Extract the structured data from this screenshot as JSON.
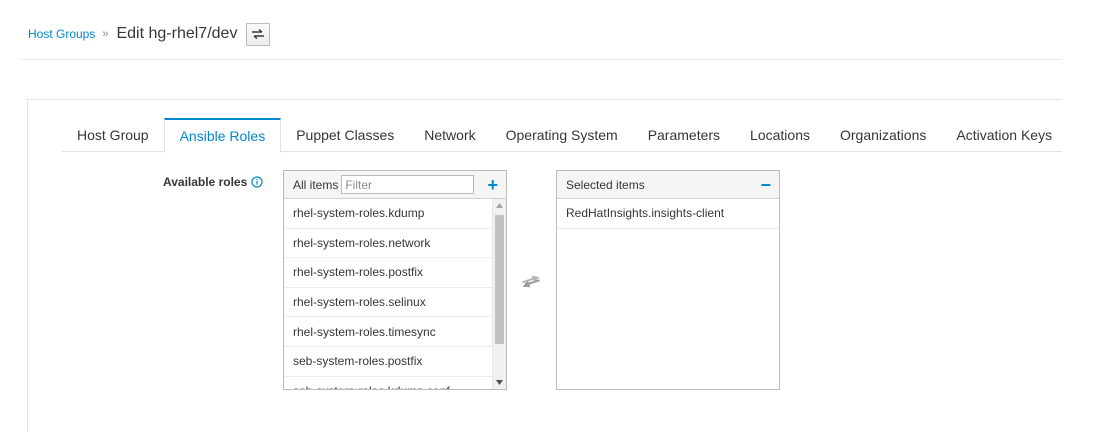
{
  "breadcrumb": {
    "parent": "Host Groups",
    "separator": "»",
    "current": "Edit hg-rhel7/dev"
  },
  "tabs": [
    {
      "label": "Host Group",
      "active": false
    },
    {
      "label": "Ansible Roles",
      "active": true
    },
    {
      "label": "Puppet Classes",
      "active": false
    },
    {
      "label": "Network",
      "active": false
    },
    {
      "label": "Operating System",
      "active": false
    },
    {
      "label": "Parameters",
      "active": false
    },
    {
      "label": "Locations",
      "active": false
    },
    {
      "label": "Organizations",
      "active": false
    },
    {
      "label": "Activation Keys",
      "active": false
    }
  ],
  "roles": {
    "label": "Available roles",
    "available": {
      "header": "All items",
      "filter_placeholder": "Filter",
      "add_symbol": "+",
      "items": [
        "rhel-system-roles.kdump",
        "rhel-system-roles.network",
        "rhel-system-roles.postfix",
        "rhel-system-roles.selinux",
        "rhel-system-roles.timesync",
        "seb-system-roles.postfix",
        "seb-system-roles.kdump.conf"
      ]
    },
    "selected": {
      "header": "Selected items",
      "remove_symbol": "−",
      "items": [
        "RedHatInsights.insights-client"
      ]
    }
  },
  "colors": {
    "accent": "#0088ce",
    "text": "#363636",
    "border": "#bbbbbb"
  },
  "icons": {
    "switcher": "exchange-icon",
    "info": "info-circle-icon",
    "transfer": "transfer-arrows-icon"
  }
}
